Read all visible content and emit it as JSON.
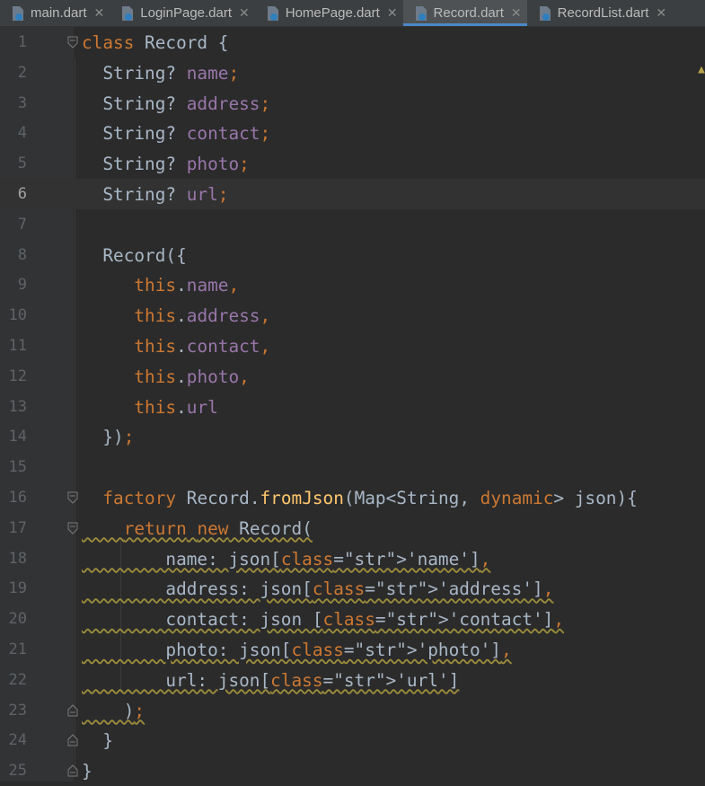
{
  "tabs": [
    {
      "label": "main.dart",
      "active": false,
      "icon": "dart-file-icon"
    },
    {
      "label": "LoginPage.dart",
      "active": false,
      "icon": "dart-file-icon"
    },
    {
      "label": "HomePage.dart",
      "active": false,
      "icon": "dart-file-icon"
    },
    {
      "label": "Record.dart",
      "active": true,
      "icon": "dart-file-icon"
    },
    {
      "label": "RecordList.dart",
      "active": false,
      "icon": "dart-file-icon"
    }
  ],
  "editor": {
    "current_line": 6,
    "lines": [
      {
        "n": "1",
        "text": "class Record {"
      },
      {
        "n": "2",
        "text": "  String? name;"
      },
      {
        "n": "3",
        "text": "  String? address;"
      },
      {
        "n": "4",
        "text": "  String? contact;"
      },
      {
        "n": "5",
        "text": "  String? photo;"
      },
      {
        "n": "6",
        "text": "  String? url;"
      },
      {
        "n": "7",
        "text": ""
      },
      {
        "n": "8",
        "text": "  Record({"
      },
      {
        "n": "9",
        "text": "     this.name,"
      },
      {
        "n": "10",
        "text": "     this.address,"
      },
      {
        "n": "11",
        "text": "     this.contact,"
      },
      {
        "n": "12",
        "text": "     this.photo,"
      },
      {
        "n": "13",
        "text": "     this.url"
      },
      {
        "n": "14",
        "text": "  });"
      },
      {
        "n": "15",
        "text": ""
      },
      {
        "n": "16",
        "text": "  factory Record.fromJson(Map<String, dynamic> json){"
      },
      {
        "n": "17",
        "text": "    return new Record("
      },
      {
        "n": "18",
        "text": "        name: json['name'],"
      },
      {
        "n": "19",
        "text": "        address: json['address'],"
      },
      {
        "n": "20",
        "text": "        contact: json ['contact'],"
      },
      {
        "n": "21",
        "text": "        photo: json['photo'],"
      },
      {
        "n": "22",
        "text": "        url: json['url']"
      },
      {
        "n": "23",
        "text": "    );"
      },
      {
        "n": "24",
        "text": "  }"
      },
      {
        "n": "25",
        "text": "}"
      }
    ]
  },
  "colors": {
    "background": "#2b2b2b",
    "keyword": "#cc7832",
    "field": "#9876aa",
    "string": "#6a8759",
    "function": "#ffc66d",
    "text": "#a9b7c6"
  }
}
